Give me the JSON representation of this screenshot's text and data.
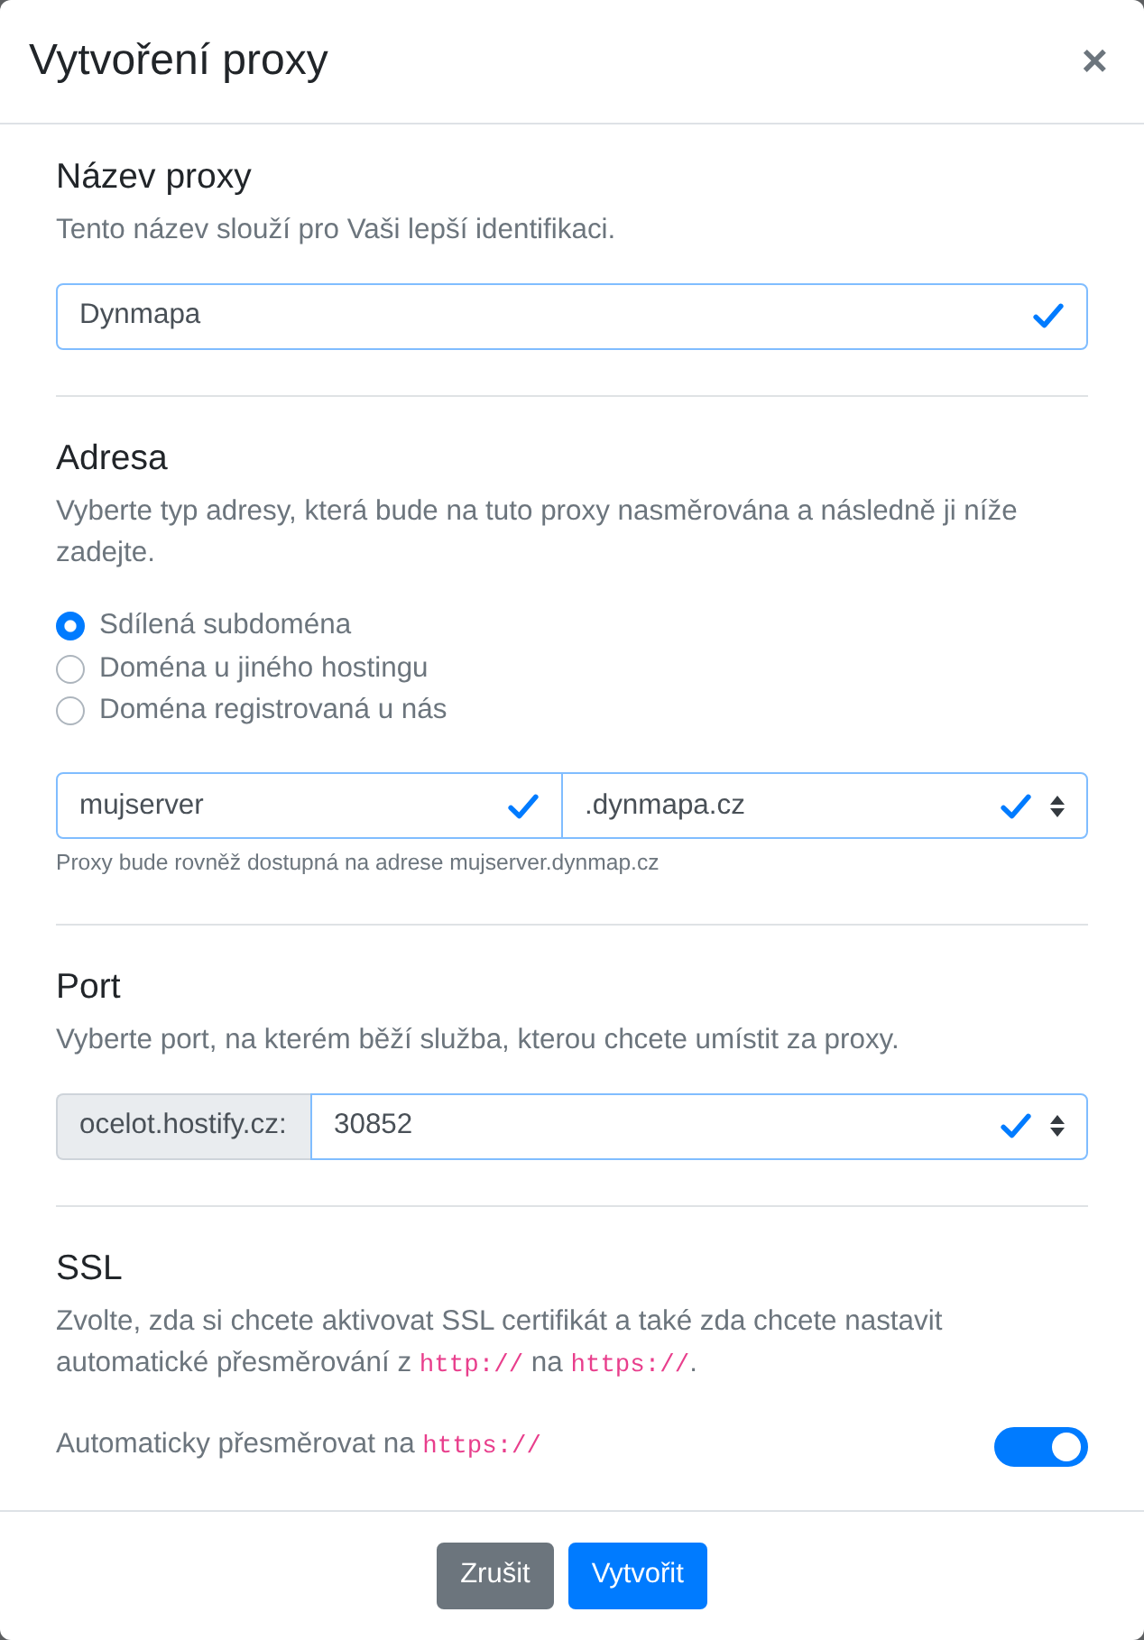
{
  "modal": {
    "title": "Vytvoření proxy",
    "close": "×"
  },
  "sections": [
    {
      "kind": "name",
      "heading": "Název proxy",
      "description": [
        {
          "kind": "text",
          "text": "Tento název slouží pro Vaši lepší identifikaci."
        }
      ],
      "field": {
        "value": "Dynmapa",
        "valid": true
      }
    },
    {
      "kind": "address",
      "heading": "Adresa",
      "description": [
        {
          "kind": "text",
          "text": "Vyberte typ adresy, která bude na tuto proxy nasměrována a následně ji níže zadejte."
        }
      ],
      "options": [
        {
          "label": "Sdílená subdoména",
          "selected": true
        },
        {
          "label": "Doména u jiného hostingu",
          "selected": false
        },
        {
          "label": "Doména registrovaná u nás",
          "selected": false
        }
      ],
      "subdomain": {
        "value": "mujserver",
        "valid": true
      },
      "domain": {
        "value": ".dynmapa.cz",
        "valid": true
      },
      "help": "Proxy bude rovněž dostupná na adrese mujserver.dynmap.cz"
    },
    {
      "kind": "port",
      "heading": "Port",
      "description": [
        {
          "kind": "text",
          "text": "Vyberte port, na kterém běží služba, kterou chcete umístit za proxy."
        }
      ],
      "prefix": "ocelot.hostify.cz:",
      "port": {
        "value": "30852",
        "valid": true
      }
    },
    {
      "kind": "ssl",
      "heading": "SSL",
      "description": [
        {
          "kind": "text",
          "text": "Zvolte, zda si chcete aktivovat SSL certifikát a také zda chcete nastavit automatické přesměrování z "
        },
        {
          "kind": "code",
          "text": "http://"
        },
        {
          "kind": "text",
          "text": " na "
        },
        {
          "kind": "code",
          "text": "https://"
        },
        {
          "kind": "text",
          "text": "."
        }
      ],
      "redirect": {
        "label": [
          {
            "kind": "text",
            "text": "Automaticky přesměrovat na "
          },
          {
            "kind": "code",
            "text": "https://"
          }
        ],
        "on": true
      }
    }
  ],
  "buttons": [
    {
      "label": "Zrušit",
      "kind": "secondary"
    },
    {
      "label": "Vytvořit",
      "kind": "primary"
    }
  ]
}
